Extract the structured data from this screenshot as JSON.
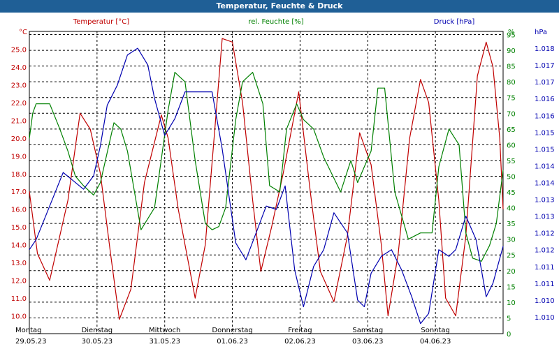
{
  "chart_data": {
    "type": "line",
    "title": "Temperatur, Feuchte & Druck",
    "x_axis": {
      "day_labels": [
        "Montag",
        "Dienstag",
        "Mittwoch",
        "Donnerstag",
        "Freitag",
        "Samstag",
        "Sonntag"
      ],
      "date_labels": [
        "29.05.23",
        "30.05.23",
        "31.05.23",
        "01.06.23",
        "02.06.23",
        "03.06.23",
        "04.06.23"
      ],
      "range_days": [
        0,
        7
      ]
    },
    "y_left": {
      "unit": "°C",
      "range": [
        9.0,
        26.0
      ],
      "ticks": [
        "10.0",
        "11.0",
        "12.0",
        "13.0",
        "14.0",
        "15.0",
        "16.0",
        "17.0",
        "18.0",
        "19.0",
        "20.0",
        "21.0",
        "22.0",
        "23.0",
        "24.0",
        "25.0"
      ]
    },
    "y_humidity": {
      "unit": "%",
      "range": [
        0,
        96
      ],
      "ticks": [
        "0",
        "5",
        "10",
        "15",
        "20",
        "25",
        "30",
        "35",
        "40",
        "45",
        "50",
        "55",
        "60",
        "65",
        "70",
        "75",
        "80",
        "85",
        "90",
        "95"
      ]
    },
    "y_right": {
      "unit": "hPa",
      "range": [
        1.0095,
        1.0185
      ],
      "ticks": [
        "1.010",
        "1.010",
        "1.011",
        "1.011",
        "1.012",
        "1.012",
        "1.013",
        "1.013",
        "1.014",
        "1.014",
        "1.015",
        "1.015",
        "1.016",
        "1.016",
        "1.017",
        "1.017",
        "1.018"
      ]
    },
    "series": [
      {
        "name": "Temperatur [°C]",
        "color": "#c00000",
        "axis": "left",
        "x": [
          0,
          0.12,
          0.3,
          0.45,
          0.57,
          0.75,
          0.9,
          1.05,
          1.2,
          1.33,
          1.5,
          1.7,
          1.95,
          2.05,
          2.2,
          2.45,
          2.6,
          2.73,
          2.85,
          3.0,
          3.15,
          3.3,
          3.42,
          3.58,
          3.75,
          3.98,
          4.15,
          4.3,
          4.5,
          4.7,
          4.88,
          5.05,
          5.2,
          5.3,
          5.45,
          5.62,
          5.78,
          5.9,
          6.05,
          6.15,
          6.3,
          6.45,
          6.62,
          6.75,
          6.85,
          6.95,
          7.0
        ],
        "y": [
          17.0,
          13.5,
          12.0,
          14.5,
          16.5,
          21.4,
          20.5,
          18.0,
          13.5,
          9.8,
          11.5,
          17.5,
          21.3,
          20.0,
          16.0,
          11.0,
          14.0,
          20.0,
          25.6,
          25.4,
          22.0,
          16.5,
          12.5,
          15.0,
          18.0,
          22.6,
          17.0,
          12.5,
          10.8,
          14.5,
          20.3,
          18.5,
          14.0,
          10.0,
          13.5,
          20.0,
          23.3,
          22.0,
          16.5,
          11.0,
          10.0,
          14.5,
          23.5,
          25.4,
          24.0,
          20.0,
          16.0
        ]
      },
      {
        "name": "rel. Feuchte [%]",
        "color": "#008000",
        "axis": "humidity",
        "x": [
          0,
          0.05,
          0.1,
          0.2,
          0.3,
          0.45,
          0.57,
          0.68,
          0.8,
          0.95,
          1.05,
          1.25,
          1.35,
          1.45,
          1.65,
          1.85,
          2.05,
          2.15,
          2.3,
          2.45,
          2.6,
          2.7,
          2.8,
          2.9,
          3.05,
          3.15,
          3.3,
          3.45,
          3.55,
          3.7,
          3.8,
          3.95,
          4.05,
          4.2,
          4.35,
          4.6,
          4.75,
          4.85,
          4.95,
          5.05,
          5.15,
          5.25,
          5.4,
          5.6,
          5.78,
          5.95,
          6.05,
          6.2,
          6.35,
          6.45,
          6.55,
          6.68,
          6.8,
          6.9,
          7.0
        ],
        "y": [
          62,
          70,
          73,
          73,
          73,
          65,
          58,
          50,
          47,
          44,
          48,
          67,
          65,
          58,
          33,
          40,
          71,
          83,
          80,
          55,
          35,
          33,
          34,
          40,
          68,
          80,
          83,
          73,
          47,
          45,
          65,
          73,
          68,
          65,
          56,
          45,
          55,
          48,
          53,
          58,
          78,
          78,
          45,
          30,
          32,
          32,
          53,
          65,
          60,
          32,
          24,
          23,
          28,
          35,
          52
        ]
      },
      {
        "name": "Druck [hPa]",
        "color": "#0000b0",
        "axis": "right",
        "x": [
          0,
          0.1,
          0.3,
          0.5,
          0.62,
          0.8,
          0.95,
          1.05,
          1.15,
          1.3,
          1.45,
          1.6,
          1.75,
          1.85,
          2.0,
          2.15,
          2.3,
          2.5,
          2.7,
          2.85,
          3.05,
          3.2,
          3.35,
          3.5,
          3.65,
          3.78,
          3.92,
          4.05,
          4.2,
          4.35,
          4.5,
          4.7,
          4.85,
          4.95,
          5.05,
          5.2,
          5.35,
          5.5,
          5.65,
          5.78,
          5.9,
          6.05,
          6.2,
          6.3,
          6.45,
          6.6,
          6.75,
          6.85,
          7.0
        ],
        "y": [
          1.012,
          1.0123,
          1.0133,
          1.0143,
          1.0141,
          1.0138,
          1.0142,
          1.0151,
          1.0163,
          1.0169,
          1.0178,
          1.018,
          1.0175,
          1.0165,
          1.0154,
          1.0159,
          1.0167,
          1.0167,
          1.0167,
          1.015,
          1.0122,
          1.0117,
          1.0125,
          1.0133,
          1.0132,
          1.0139,
          1.0114,
          1.0103,
          1.0115,
          1.012,
          1.0131,
          1.0125,
          1.0105,
          1.0103,
          1.0113,
          1.0118,
          1.012,
          1.0114,
          1.0106,
          1.0098,
          1.0101,
          1.012,
          1.0118,
          1.012,
          1.013,
          1.0123,
          1.0106,
          1.011,
          1.0121
        ]
      }
    ]
  }
}
